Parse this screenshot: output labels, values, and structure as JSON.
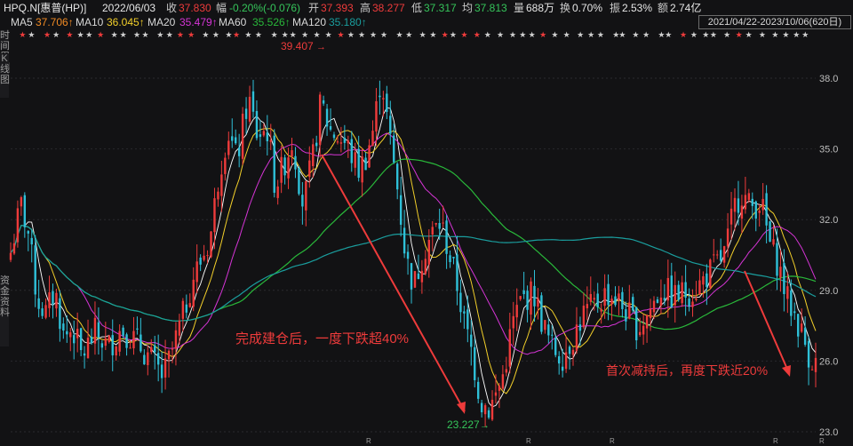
{
  "header": {
    "symbol": "HPQ.N[惠普(HP)]",
    "date": "2022/06/03",
    "close_label": "收",
    "close_value": "37.830",
    "change_label": "幅",
    "change_value": "-0.20%(-0.076)",
    "open_label": "开",
    "open_value": "37.393",
    "high_label": "高",
    "high_value": "38.277",
    "low_label": "低",
    "low_value": "37.317",
    "avg_label": "均",
    "avg_value": "37.813",
    "volume_label": "量",
    "volume_value": "688万",
    "turnover_label": "换",
    "turnover_value": "0.70%",
    "amplitude_label": "振",
    "amplitude_value": "2.53%",
    "amount_label": "额",
    "amount_value": "2.74亿"
  },
  "ma_legend": {
    "ma5_label": "MA5",
    "ma5_value": "37.706↑",
    "ma10_label": "MA10",
    "ma10_value": "36.045↑",
    "ma20_label": "MA20",
    "ma20_value": "35.479↑",
    "ma60_label": "MA60",
    "ma60_value": "35.526↑",
    "ma120_label": "MA120",
    "ma120_value": "35.180↑"
  },
  "range_box": "2021/04/22-2023/10/06(620日)",
  "side_tabs": {
    "top": "时间周期",
    "mid": "K线图",
    "bottom": "资金资料"
  },
  "colors": {
    "bg": "#121214",
    "up": "#ee3b3b",
    "down": "#2fc0d8",
    "ma5": "#ffffff",
    "ma10": "#f2cf2a",
    "ma20": "#d534d5",
    "ma60": "#29b83a",
    "ma120": "#1a9e9e",
    "annotation": "#ee3b3b",
    "low_marker": "#35c45a"
  },
  "chart_data": {
    "type": "candlestick",
    "y_ticks": [
      "38.0",
      "35.0",
      "32.0",
      "29.0",
      "26.0",
      "23.0"
    ],
    "ylim": [
      23.0,
      39.0
    ],
    "x_range": [
      "2021/04/22",
      "2023/10/06"
    ],
    "trading_days": 620,
    "high_marker": "39.407",
    "low_marker": "23.227",
    "annotations": [
      "完成建仓后，一度下跌超40%",
      "首次减持后，再度下跌近20%"
    ],
    "r_markers": [
      "R",
      "R",
      "R",
      "R",
      "R"
    ],
    "price_path": [
      [
        0,
        30.6
      ],
      [
        6,
        31.7
      ],
      [
        12,
        32.6
      ],
      [
        20,
        31.4
      ],
      [
        30,
        28.6
      ],
      [
        40,
        28.0
      ],
      [
        50,
        29.0
      ],
      [
        60,
        27.0
      ],
      [
        70,
        27.4
      ],
      [
        80,
        26.2
      ],
      [
        95,
        27.2
      ],
      [
        110,
        26.6
      ],
      [
        125,
        27.4
      ],
      [
        140,
        26.9
      ],
      [
        160,
        26.0
      ],
      [
        172,
        25.3
      ],
      [
        182,
        26.4
      ],
      [
        195,
        28.0
      ],
      [
        205,
        29.5
      ],
      [
        215,
        30.3
      ],
      [
        225,
        31.2
      ],
      [
        235,
        34.0
      ],
      [
        245,
        35.8
      ],
      [
        255,
        34.5
      ],
      [
        268,
        37.2
      ],
      [
        278,
        35.6
      ],
      [
        290,
        35.8
      ],
      [
        298,
        33.5
      ],
      [
        305,
        34.0
      ],
      [
        318,
        35.4
      ],
      [
        330,
        32.6
      ],
      [
        340,
        34.4
      ],
      [
        350,
        37.0
      ],
      [
        360,
        35.8
      ],
      [
        370,
        35.5
      ],
      [
        380,
        35.1
      ],
      [
        392,
        34.1
      ],
      [
        400,
        34.6
      ],
      [
        410,
        36.0
      ],
      [
        418,
        38.2
      ],
      [
        426,
        35.8
      ],
      [
        436,
        33.4
      ],
      [
        446,
        30.3
      ],
      [
        455,
        29.2
      ],
      [
        465,
        30.6
      ],
      [
        475,
        31.4
      ],
      [
        485,
        31.9
      ],
      [
        495,
        30.5
      ],
      [
        505,
        29.0
      ],
      [
        512,
        27.5
      ],
      [
        520,
        26.4
      ],
      [
        530,
        24.3
      ],
      [
        540,
        24.0
      ],
      [
        548,
        24.6
      ],
      [
        556,
        25.5
      ],
      [
        566,
        27.6
      ],
      [
        576,
        28.6
      ],
      [
        590,
        28.9
      ],
      [
        600,
        27.6
      ],
      [
        610,
        26.6
      ],
      [
        622,
        26.2
      ],
      [
        634,
        27.0
      ],
      [
        646,
        28.0
      ],
      [
        660,
        28.4
      ],
      [
        672,
        28.9
      ],
      [
        684,
        28.6
      ],
      [
        696,
        28.0
      ],
      [
        708,
        27.4
      ],
      [
        720,
        28.1
      ],
      [
        734,
        29.1
      ],
      [
        748,
        28.7
      ],
      [
        760,
        28.9
      ],
      [
        772,
        29.0
      ],
      [
        784,
        29.6
      ],
      [
        796,
        30.1
      ],
      [
        806,
        30.6
      ],
      [
        816,
        32.5
      ],
      [
        824,
        33.2
      ],
      [
        834,
        32.5
      ],
      [
        846,
        32.8
      ],
      [
        856,
        31.0
      ],
      [
        866,
        30.1
      ],
      [
        876,
        28.6
      ],
      [
        884,
        28.0
      ],
      [
        892,
        27.2
      ],
      [
        900,
        26.3
      ],
      [
        908,
        25.9
      ]
    ]
  }
}
